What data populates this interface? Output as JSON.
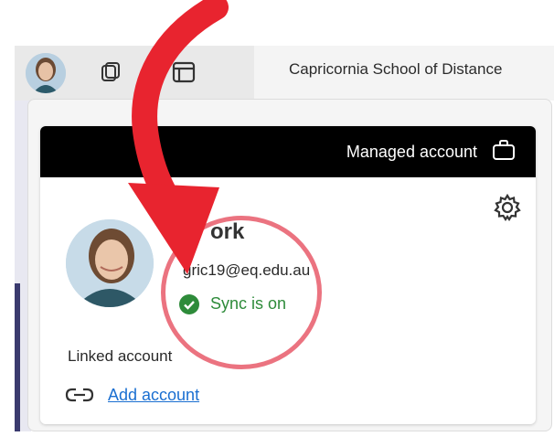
{
  "browser": {
    "tab_title": "Capricornia School of Distance",
    "icons": {
      "profile": "profile-avatar-icon",
      "workspaces": "workspaces-icon",
      "tab_actions": "tab-actions-icon"
    }
  },
  "profile_panel": {
    "managed_label": "Managed account",
    "managed_icon": "briefcase-icon",
    "settings_icon": "gear-icon",
    "name": "ork",
    "email": "gric19@eq.edu.au",
    "sync_status": "Sync is on",
    "sync_color": "#2e8b3a",
    "linked_label": "Linked account",
    "link_icon": "link-icon",
    "add_account_label": "Add account",
    "link_color": "#1a6fd1"
  },
  "annotations": {
    "arrow_color": "#e8242f",
    "circle_color": "#e1283c"
  }
}
